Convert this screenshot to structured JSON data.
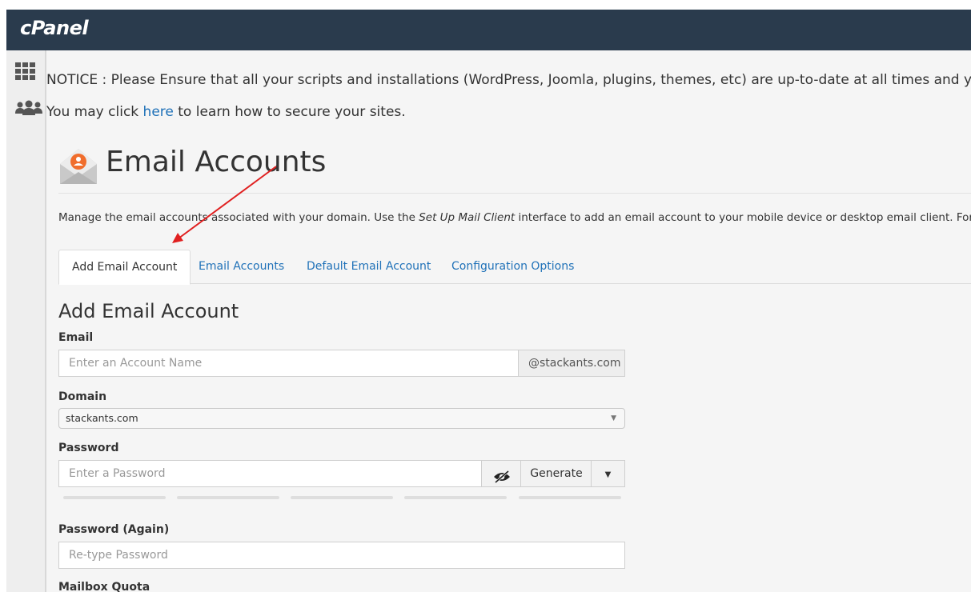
{
  "app": {
    "logo": "cPanel"
  },
  "sidebar": {
    "items": [
      {
        "icon": "grid-icon"
      },
      {
        "icon": "users-icon"
      }
    ]
  },
  "notice": {
    "line1": "NOTICE : Please Ensure that all your scripts and installations (WordPress, Joomla, plugins, themes, etc) are up-to-date at all times and yo",
    "line2_prefix": "You may click ",
    "line2_link": "here",
    "line2_suffix": " to learn how to secure your sites."
  },
  "page": {
    "title": "Email Accounts",
    "description_prefix": "Manage the email accounts associated with your domain. Use the ",
    "description_emphasis": "Set Up Mail Client",
    "description_suffix": " interface to add an email account to your mobile device or desktop email client. For more"
  },
  "tabs": [
    {
      "label": "Add Email Account",
      "active": true
    },
    {
      "label": "Email Accounts",
      "active": false
    },
    {
      "label": "Default Email Account",
      "active": false
    },
    {
      "label": "Configuration Options",
      "active": false
    }
  ],
  "form": {
    "section_title": "Add Email Account",
    "email": {
      "label": "Email",
      "placeholder": "Enter an Account Name",
      "domain_suffix": "@stackants.com"
    },
    "domain": {
      "label": "Domain",
      "selected": "stackants.com"
    },
    "password": {
      "label": "Password",
      "placeholder": "Enter a Password",
      "generate_label": "Generate"
    },
    "password_again": {
      "label": "Password (Again)",
      "placeholder": "Re-type Password"
    },
    "mailbox_quota": {
      "label": "Mailbox Quota"
    }
  },
  "colors": {
    "topbar": "#2a3b4d",
    "link": "#1f71b8",
    "annotation_arrow": "#e02020",
    "icon_orange": "#f06d2c"
  }
}
